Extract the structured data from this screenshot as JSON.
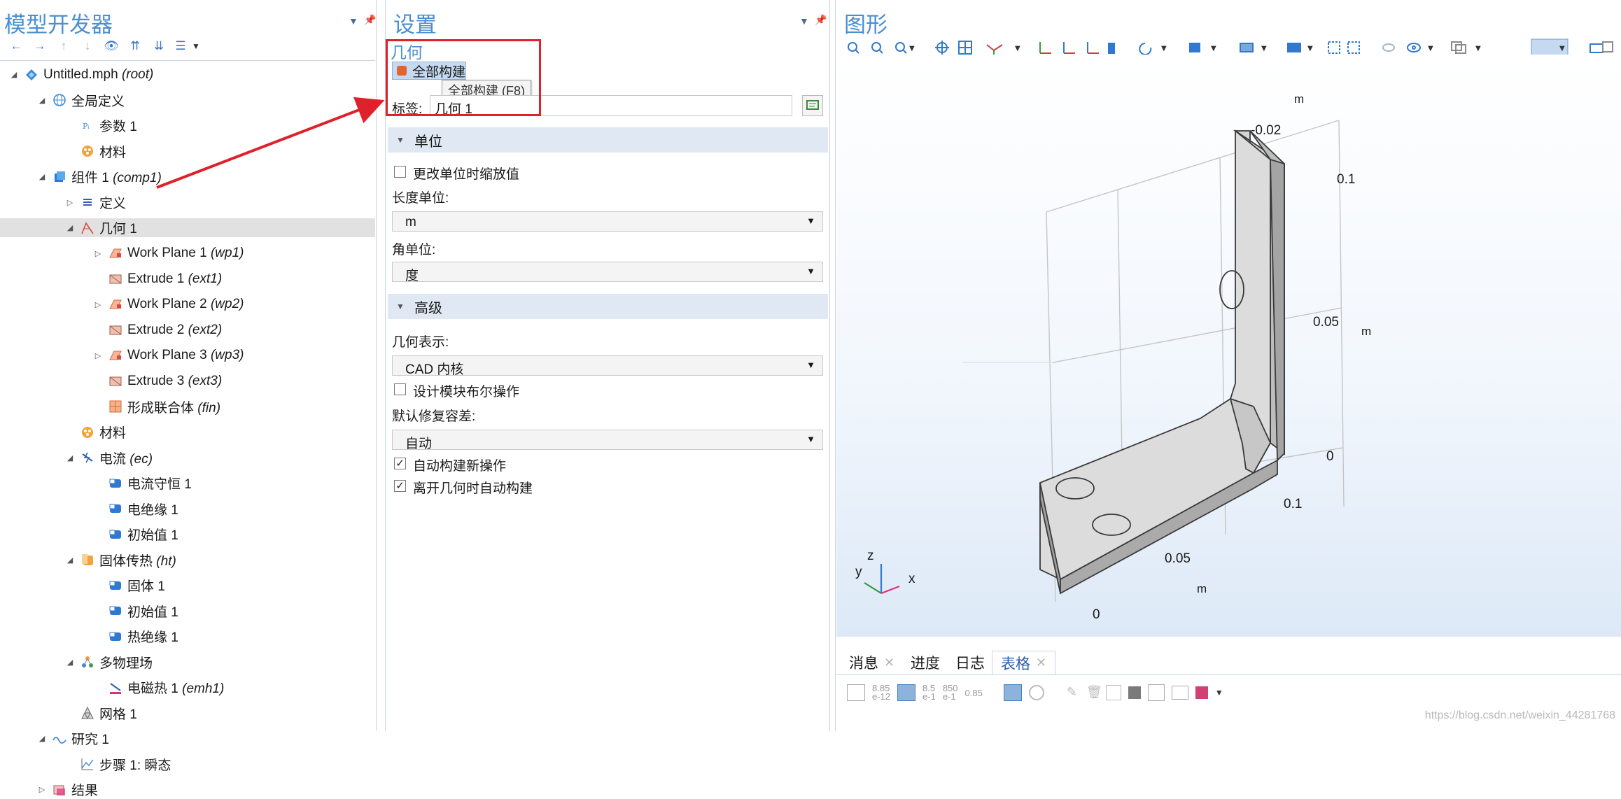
{
  "model_builder": {
    "title": "模型开发器",
    "toolbar_icons": [
      "←",
      "→",
      "↑",
      "↓",
      "👁",
      "⇈",
      "⇊",
      "☰",
      "▾"
    ],
    "tree": [
      {
        "level": 0,
        "expand": "open",
        "icon": "model",
        "label": "Untitled.mph",
        "tag": "(root)"
      },
      {
        "level": 1,
        "expand": "open",
        "icon": "globe",
        "label": "全局定义",
        "tag": ""
      },
      {
        "level": 2,
        "expand": "",
        "icon": "param",
        "label": "参数 1",
        "tag": ""
      },
      {
        "level": 2,
        "expand": "",
        "icon": "materials",
        "label": "材料",
        "tag": ""
      },
      {
        "level": 1,
        "expand": "open",
        "icon": "component",
        "label": "组件 1",
        "tag": "(comp1)"
      },
      {
        "level": 2,
        "expand": "closed",
        "icon": "definitions",
        "label": "定义",
        "tag": ""
      },
      {
        "level": 2,
        "expand": "open",
        "icon": "geometry",
        "label": "几何 1",
        "tag": "",
        "selected": true
      },
      {
        "level": 3,
        "expand": "closed",
        "icon": "workplane",
        "label": "Work Plane 1",
        "tag": "(wp1)"
      },
      {
        "level": 3,
        "expand": "",
        "icon": "extrude",
        "label": "Extrude 1",
        "tag": "(ext1)"
      },
      {
        "level": 3,
        "expand": "closed",
        "icon": "workplane",
        "label": "Work Plane 2",
        "tag": "(wp2)"
      },
      {
        "level": 3,
        "expand": "",
        "icon": "extrude",
        "label": "Extrude 2",
        "tag": "(ext2)"
      },
      {
        "level": 3,
        "expand": "closed",
        "icon": "workplane",
        "label": "Work Plane 3",
        "tag": "(wp3)"
      },
      {
        "level": 3,
        "expand": "",
        "icon": "extrude",
        "label": "Extrude 3",
        "tag": "(ext3)"
      },
      {
        "level": 3,
        "expand": "",
        "icon": "union",
        "label": "形成联合体",
        "tag": "(fin)"
      },
      {
        "level": 2,
        "expand": "",
        "icon": "materials",
        "label": "材料",
        "tag": ""
      },
      {
        "level": 2,
        "expand": "open",
        "icon": "current",
        "label": "电流",
        "tag": "(ec)"
      },
      {
        "level": 3,
        "expand": "",
        "icon": "node",
        "label": "电流守恒 1",
        "tag": ""
      },
      {
        "level": 3,
        "expand": "",
        "icon": "node",
        "label": "电绝缘 1",
        "tag": ""
      },
      {
        "level": 3,
        "expand": "",
        "icon": "node",
        "label": "初始值 1",
        "tag": ""
      },
      {
        "level": 2,
        "expand": "open",
        "icon": "heat",
        "label": "固体传热",
        "tag": "(ht)"
      },
      {
        "level": 3,
        "expand": "",
        "icon": "node",
        "label": "固体 1",
        "tag": ""
      },
      {
        "level": 3,
        "expand": "",
        "icon": "node",
        "label": "初始值 1",
        "tag": ""
      },
      {
        "level": 3,
        "expand": "",
        "icon": "node",
        "label": "热绝缘 1",
        "tag": ""
      },
      {
        "level": 2,
        "expand": "open",
        "icon": "multiphysics",
        "label": "多物理场",
        "tag": ""
      },
      {
        "level": 3,
        "expand": "",
        "icon": "emheat",
        "label": "电磁热 1",
        "tag": "(emh1)"
      },
      {
        "level": 2,
        "expand": "",
        "icon": "mesh",
        "label": "网格 1",
        "tag": ""
      },
      {
        "level": 1,
        "expand": "open",
        "icon": "study",
        "label": "研究 1",
        "tag": ""
      },
      {
        "level": 2,
        "expand": "",
        "icon": "step",
        "label": "步骤 1: 瞬态",
        "tag": ""
      },
      {
        "level": 1,
        "expand": "closed",
        "icon": "results",
        "label": "结果",
        "tag": ""
      }
    ]
  },
  "settings": {
    "title": "设置",
    "subtitle": "几何",
    "build_all_label": "全部构建",
    "tooltip": "全部构建 (F8)",
    "label_caption": "标签:",
    "label_value": "几何 1",
    "units_section": "单位",
    "scale_values_label": "更改单位时缩放值",
    "length_unit_label": "长度单位:",
    "length_unit_value": "m",
    "angle_unit_label": "角单位:",
    "angle_unit_value": "度",
    "advanced_section": "高级",
    "geom_repr_label": "几何表示:",
    "geom_repr_value": "CAD 内核",
    "design_boolean_label": "设计模块布尔操作",
    "repair_tol_label": "默认修复容差:",
    "repair_tol_value": "自动",
    "auto_build_new_label": "自动构建新操作",
    "auto_build_leave_label": "离开几何时自动构建",
    "checks": {
      "scale_values": false,
      "design_boolean": false,
      "auto_build_new": true,
      "auto_build_leave": true
    }
  },
  "graphics": {
    "title": "图形",
    "axis_ticks": {
      "top_unit": "m",
      "top_val": "-0.02",
      "right_01": "0.1",
      "right_005": "0.05",
      "right_unit": "m",
      "right_0": "0",
      "bottom_01": "0.1",
      "bottom_005": "0.05",
      "bottom_unit": "m",
      "bottom_0": "0"
    },
    "triad": {
      "x": "x",
      "y": "y",
      "z": "z"
    }
  },
  "bottom_tabs": [
    {
      "label": "消息",
      "closable": true,
      "active": false
    },
    {
      "label": "进度",
      "closable": false,
      "active": false
    },
    {
      "label": "日志",
      "closable": false,
      "active": false
    },
    {
      "label": "表格",
      "closable": true,
      "active": true
    }
  ],
  "bottom_toolbar": {
    "t1": "8.85",
    "t1b": "e-12",
    "t2": "8.5",
    "t2b": "e-1",
    "t3": "850",
    "t3b": "e-1",
    "t4": "0.85"
  },
  "watermark": "https://blog.csdn.net/weixin_44281768",
  "colors": {
    "accent": "#4a8fd0",
    "section_bg": "#dfe8f3",
    "selection": "#e1e1e1",
    "annotation": "#e0202a"
  }
}
